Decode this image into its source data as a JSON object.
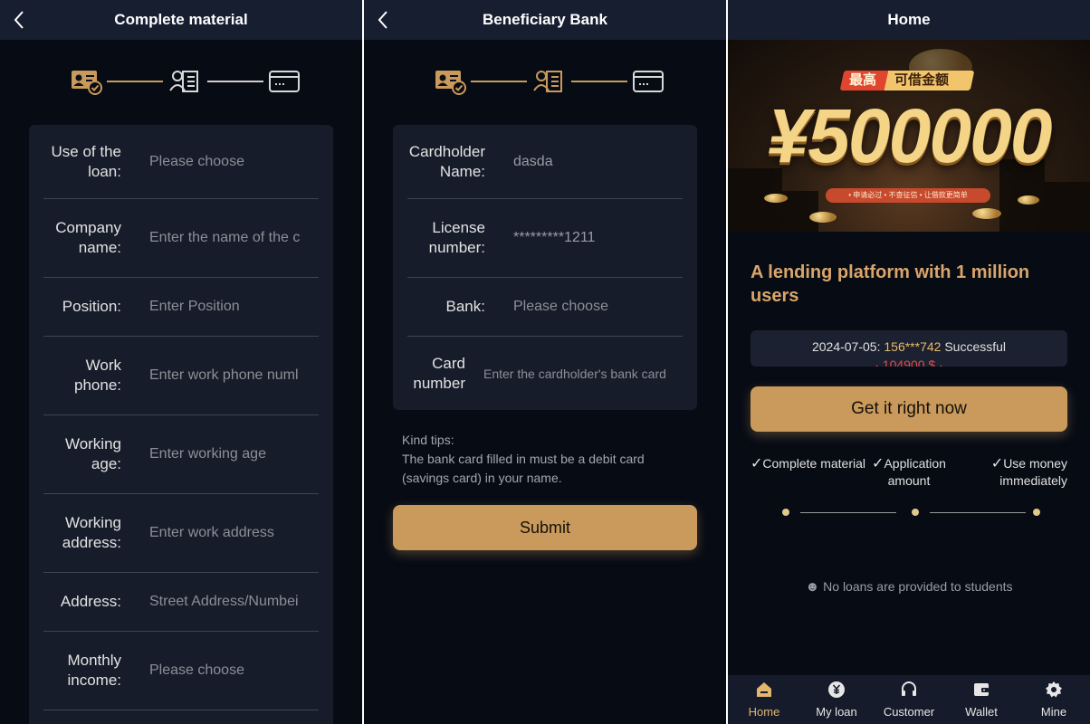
{
  "colors": {
    "gold": "#c99a5b",
    "panel_bg": "#070b14",
    "card_bg": "#161c2a",
    "topbar_bg": "#171e30"
  },
  "screen1": {
    "title": "Complete material",
    "fields": [
      {
        "label": "Use of the loan:",
        "value": "Please choose"
      },
      {
        "label": "Company name:",
        "value": "Enter the name of the c"
      },
      {
        "label": "Position:",
        "value": "Enter Position"
      },
      {
        "label": "Work phone:",
        "value": "Enter work phone numl"
      },
      {
        "label": "Working age:",
        "value": "Enter working age"
      },
      {
        "label": "Working address:",
        "value": "Enter work address"
      },
      {
        "label": "Address:",
        "value": "Street Address/Numbei"
      },
      {
        "label": "Monthly income:",
        "value": "Please choose"
      }
    ]
  },
  "screen2": {
    "title": "Beneficiary Bank",
    "fields": [
      {
        "label": "Cardholder Name:",
        "value": "dasda"
      },
      {
        "label": "License number:",
        "value": "*********1211"
      },
      {
        "label": "Bank:",
        "value": "Please choose"
      },
      {
        "label": "Card number",
        "value": "Enter the cardholder's bank card"
      }
    ],
    "tips_title": "Kind tips:",
    "tips_text": "The bank card filled in must be a debit card (savings card) in your name.",
    "submit_label": "Submit"
  },
  "screen3": {
    "title": "Home",
    "banner": {
      "tag_left": "最高",
      "tag_right": "可借金额",
      "amount": "¥500000",
      "pill": "• 申请必过 • 不查征信 • 让借款更简单"
    },
    "headline": "A lending platform with 1 million users",
    "ticker": {
      "date": "2024-07-05:",
      "phone": "156***742",
      "status": "Successful",
      "next_line": "· 104900 $ ·"
    },
    "cta_label": "Get it right now",
    "checks": [
      "Complete material",
      "Application amount",
      "Use money immediately"
    ],
    "notice": "No loans are provided to students",
    "tabs": [
      {
        "label": "Home",
        "icon": "home-icon"
      },
      {
        "label": "My loan",
        "icon": "loan-coin-icon"
      },
      {
        "label": "Customer",
        "icon": "headset-icon"
      },
      {
        "label": "Wallet",
        "icon": "wallet-icon"
      },
      {
        "label": "Mine",
        "icon": "gear-icon"
      }
    ]
  }
}
